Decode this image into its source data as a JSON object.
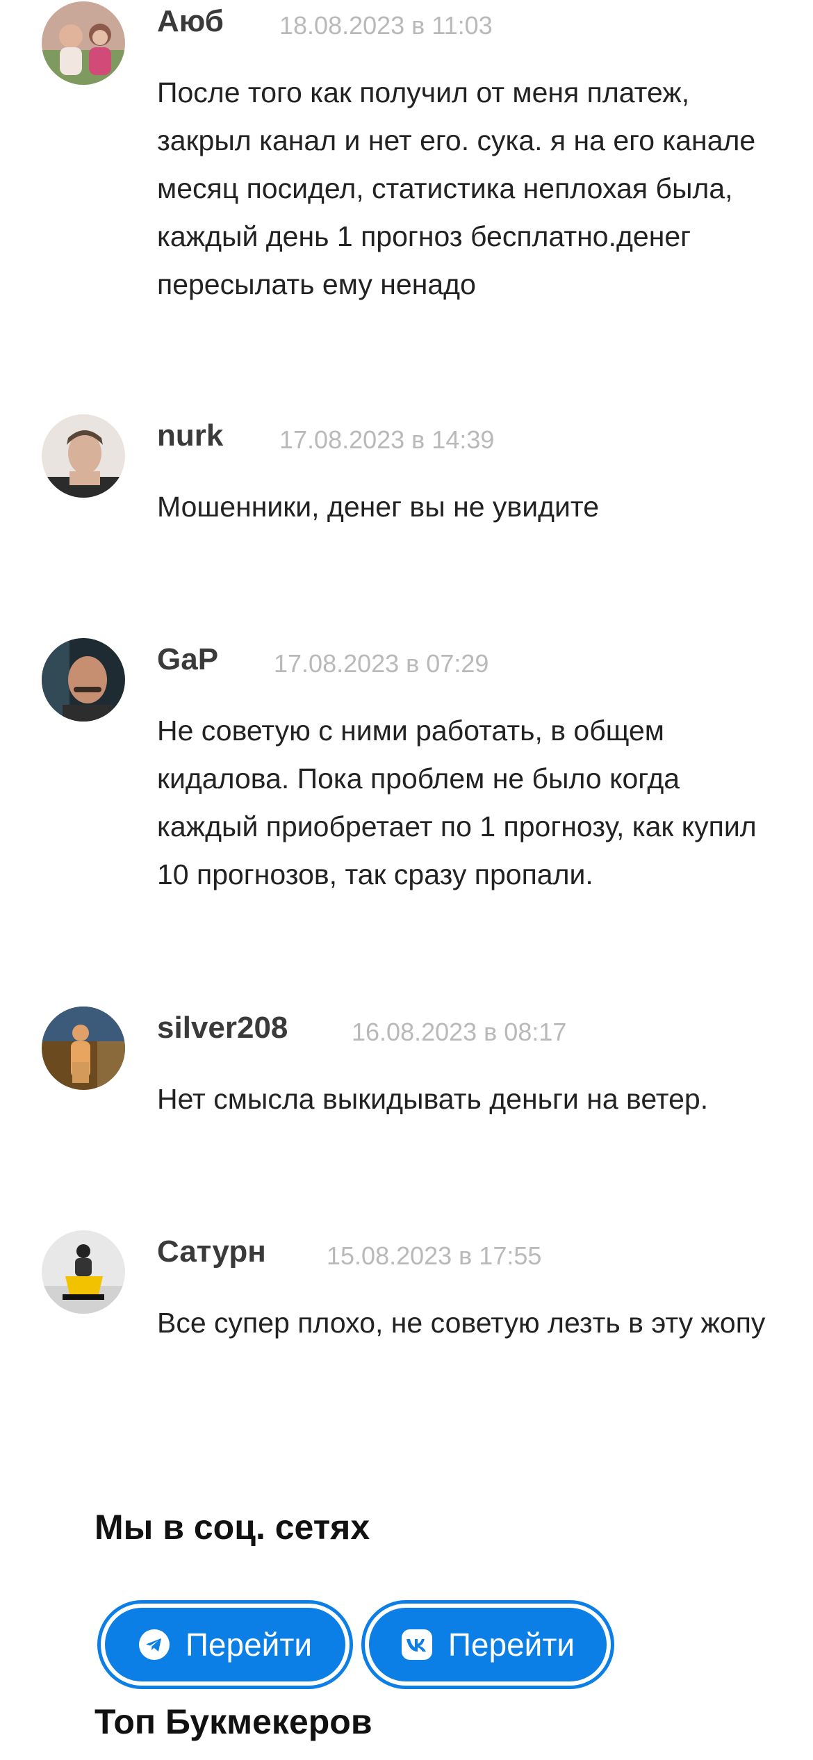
{
  "comments": [
    {
      "author": "Аюб",
      "date": "18.08.2023 в 11:03",
      "text": "После того как получил от меня платеж, закрыл канал и нет его. сука. я на его канале месяц посидел, статистика неплохая была, каждый день 1 прогноз бесплатно.денег пересылать ему ненадо"
    },
    {
      "author": "nurk",
      "date": "17.08.2023 в 14:39",
      "text": "Мошенники, денег вы не увидите"
    },
    {
      "author": "GaP",
      "date": "17.08.2023 в 07:29",
      "text": "Не советую с ними работать, в общем кидалова. Пока проблем не было когда каждый приобретает по 1 прогнозу, как купил 10 прогнозов, так сразу пропали."
    },
    {
      "author": "silver208",
      "date": "16.08.2023 в 08:17",
      "text": "Нет смысла выкидывать деньги на ветер."
    },
    {
      "author": "Сатурн",
      "date": "15.08.2023 в 17:55",
      "text": "Все супер плохо, не советую лезть в эту жопу"
    }
  ],
  "social": {
    "title": "Мы в соц. сетях",
    "buttons": [
      {
        "icon": "telegram-icon",
        "label": "Перейти"
      },
      {
        "icon": "vk-icon",
        "label": "Перейти"
      }
    ],
    "accent": "#0b7fe6"
  },
  "bookmakers": {
    "title": "Топ Букмекеров"
  }
}
